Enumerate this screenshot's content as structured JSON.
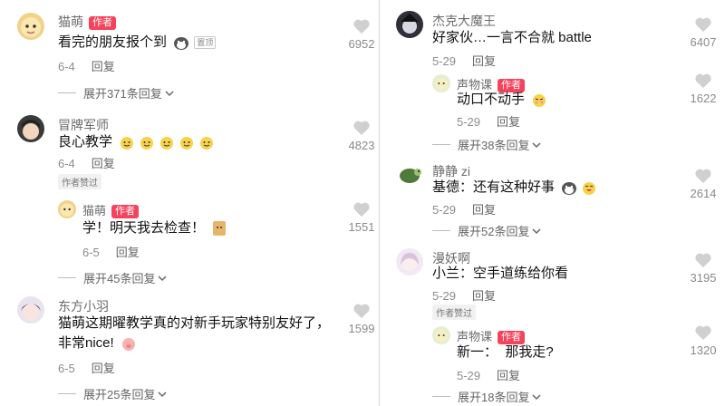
{
  "left": {
    "comments": [
      {
        "username": "猫萌",
        "author_tag": "作者",
        "text": "看完的朋友报个到",
        "pin_tag": "置顶",
        "date": "6-4",
        "reply": "回复",
        "likes": "6952",
        "expand": "展开371条回复"
      },
      {
        "username": "冒牌军师",
        "text": "良心教学",
        "date": "6-4",
        "reply": "回复",
        "likes": "4823",
        "liked_tag": "作者赞过",
        "sub": {
          "username": "猫萌",
          "author_tag": "作者",
          "text": "学！明天我去检查！",
          "date": "6-5",
          "reply": "回复",
          "likes": "1551"
        },
        "expand": "展开45条回复"
      },
      {
        "username": "东方小羽",
        "text_line1": "猫萌这期曜教学真的对新手玩家特别友好了，",
        "text_line2": "非常nice!",
        "date": "6-5",
        "reply": "回复",
        "likes": "1599",
        "expand": "展开25条回复"
      }
    ]
  },
  "right": {
    "comments": [
      {
        "username": "杰克大魔王",
        "text": "好家伙…一言不合就 battle",
        "date": "5-29",
        "reply": "回复",
        "likes": "6407",
        "sub": {
          "username": "声物课",
          "author_tag": "作者",
          "text": "动口不动手",
          "date": "5-29",
          "reply": "回复",
          "likes": "1622"
        },
        "expand": "展开38条回复"
      },
      {
        "username": "静静 zi",
        "text": "基德：还有这种好事",
        "date": "5-29",
        "reply": "回复",
        "likes": "2614",
        "expand": "展开52条回复"
      },
      {
        "username": "漫妖啊",
        "text": "小兰：空手道练给你看",
        "date": "5-29",
        "reply": "回复",
        "likes": "3195",
        "liked_tag": "作者赞过",
        "sub": {
          "username": "声物课",
          "author_tag": "作者",
          "text": "新一：  那我走?",
          "date": "5-29",
          "reply": "回复",
          "likes": "1320"
        },
        "expand": "展开18条回复"
      }
    ]
  },
  "colors": {
    "author_tag": "#f6425a",
    "like_heart": "#d0d0d0"
  },
  "icons": {
    "like": "heart-icon",
    "expand": "chevron-down-icon"
  }
}
